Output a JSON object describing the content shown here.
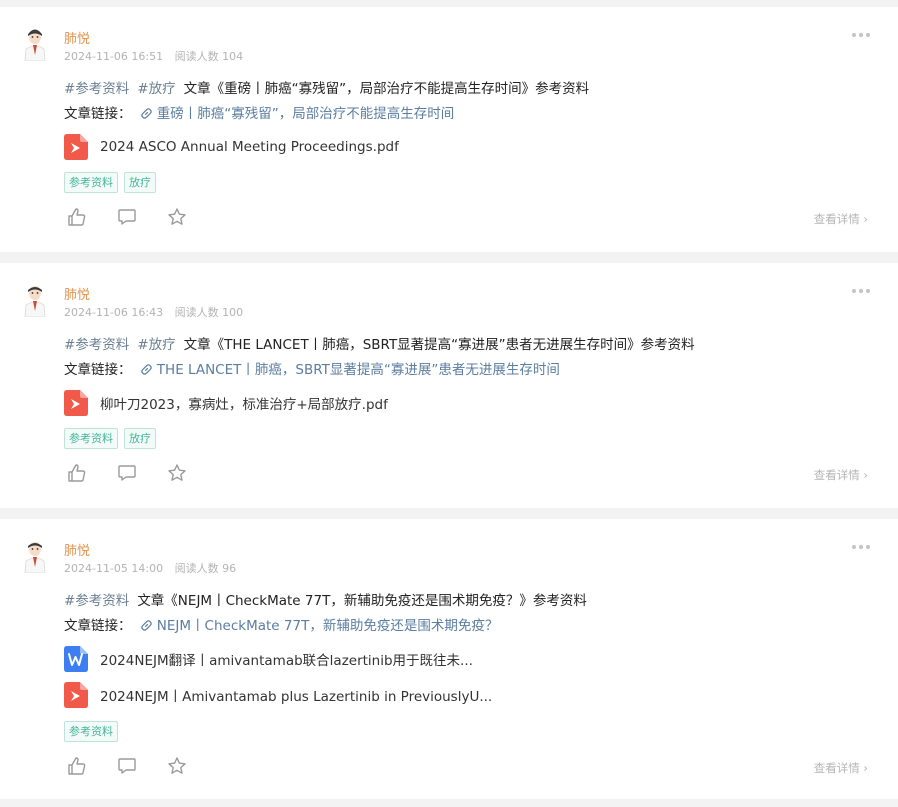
{
  "posts": [
    {
      "author": "肺悦",
      "date": "2024-11-06 16:51",
      "reads": "阅读人数 104",
      "hashtags": [
        "#参考资料",
        "#放疗"
      ],
      "title": "文章《重磅丨肺癌“寡残留”，局部治疗不能提高生存时间》参考资料",
      "link_label": "文章链接：",
      "link_text": "重磅丨肺癌“寡残留”，局部治疗不能提高生存时间",
      "files": [
        {
          "type": "pdf-icon",
          "name": "2024 ASCO Annual Meeting Proceedings.pdf"
        }
      ],
      "tags": [
        "参考资料",
        "放疗"
      ],
      "details": "查看详情 ›"
    },
    {
      "author": "肺悦",
      "date": "2024-11-06 16:43",
      "reads": "阅读人数 100",
      "hashtags": [
        "#参考资料",
        "#放疗"
      ],
      "title": "文章《THE LANCET丨肺癌，SBRT显著提高“寡进展”患者无进展生存时间》参考资料",
      "link_label": "文章链接：",
      "link_text": "THE LANCET丨肺癌，SBRT显著提高“寡进展”患者无进展生存时间",
      "files": [
        {
          "type": "pdf-icon",
          "name": "柳叶刀2023，寡病灶，标准治疗+局部放疗.pdf"
        }
      ],
      "tags": [
        "参考资料",
        "放疗"
      ],
      "details": "查看详情 ›"
    },
    {
      "author": "肺悦",
      "date": "2024-11-05 14:00",
      "reads": "阅读人数 96",
      "hashtags": [
        "#参考资料"
      ],
      "title": "文章《NEJM丨CheckMate 77T，新辅助免疫还是围术期免疫？》参考资料",
      "link_label": "文章链接：",
      "link_text": "NEJM丨CheckMate 77T，新辅助免疫还是围术期免疫？",
      "files": [
        {
          "type": "word-icon",
          "name": "2024NEJM翻译丨amivantamab联合lazertinib用于既往未..."
        },
        {
          "type": "pdf-icon",
          "name": "2024NEJM丨Amivantamab plus Lazertinib in PreviouslyU..."
        }
      ],
      "tags": [
        "参考资料"
      ],
      "details": "查看详情 ›"
    }
  ],
  "colors": {
    "author": "#e2934e",
    "hashtag": "#6b7f93",
    "link": "#5a7ea0",
    "tag": "#4ab39c",
    "pdf": "#f1594a",
    "word": "#3d7ef0"
  }
}
